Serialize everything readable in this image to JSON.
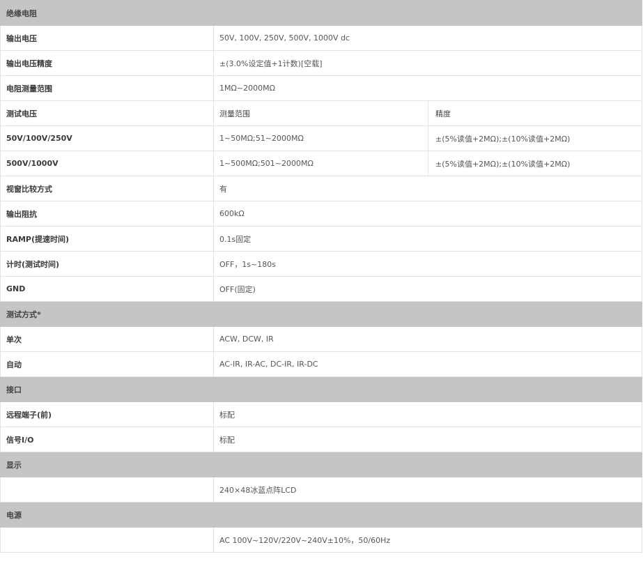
{
  "colors": {
    "section_bg": "#c5c5c5",
    "border": "#e2e2e2",
    "text": "#333333"
  },
  "rows": [
    {
      "type": "section",
      "label": "绝缘电阻"
    },
    {
      "type": "pair",
      "label": "输出电压",
      "value": "50V, 100V, 250V, 500V, 1000V dc"
    },
    {
      "type": "pair",
      "label": "输出电压精度",
      "value": "±(3.0%设定值+1计数)[空载]"
    },
    {
      "type": "pair",
      "label": "电阻测量范围",
      "value": "1MΩ~2000MΩ"
    },
    {
      "type": "triple",
      "label": "测试电压",
      "value": "测量范围",
      "extra": "精度",
      "subhead": true
    },
    {
      "type": "triple",
      "label": "50V/100V/250V",
      "value": "1~50MΩ;51~2000MΩ",
      "extra": "±(5%读值+2MΩ);±(10%读值+2MΩ)"
    },
    {
      "type": "triple",
      "label": "500V/1000V",
      "value": "1~500MΩ;501~2000MΩ",
      "extra": "±(5%读值+2MΩ);±(10%读值+2MΩ)"
    },
    {
      "type": "pair",
      "label": "视窗比较方式",
      "value": "有"
    },
    {
      "type": "pair",
      "label": "输出阻抗",
      "value": "600kΩ"
    },
    {
      "type": "pair",
      "label": "RAMP(提速时间)",
      "value": "0.1s固定"
    },
    {
      "type": "pair",
      "label": "计时(测试时间)",
      "value": "OFF，1s~180s"
    },
    {
      "type": "pair",
      "label": "GND",
      "value": "OFF(固定)"
    },
    {
      "type": "section",
      "label": "测试方式*"
    },
    {
      "type": "pair",
      "label": "单次",
      "value": "ACW, DCW, IR"
    },
    {
      "type": "pair",
      "label": "自动",
      "value": "AC-IR, IR-AC, DC-IR, IR-DC"
    },
    {
      "type": "section",
      "label": "接口"
    },
    {
      "type": "pair",
      "label": "远程端子(前)",
      "value": "标配"
    },
    {
      "type": "pair",
      "label": "信号I/O",
      "value": "标配"
    },
    {
      "type": "section",
      "label": "显示"
    },
    {
      "type": "pair",
      "label": "",
      "value": "240×48冰蓝点阵LCD"
    },
    {
      "type": "section",
      "label": "电源"
    },
    {
      "type": "pair",
      "label": "",
      "value": "AC 100V~120V/220V~240V±10%，50/60Hz"
    }
  ]
}
